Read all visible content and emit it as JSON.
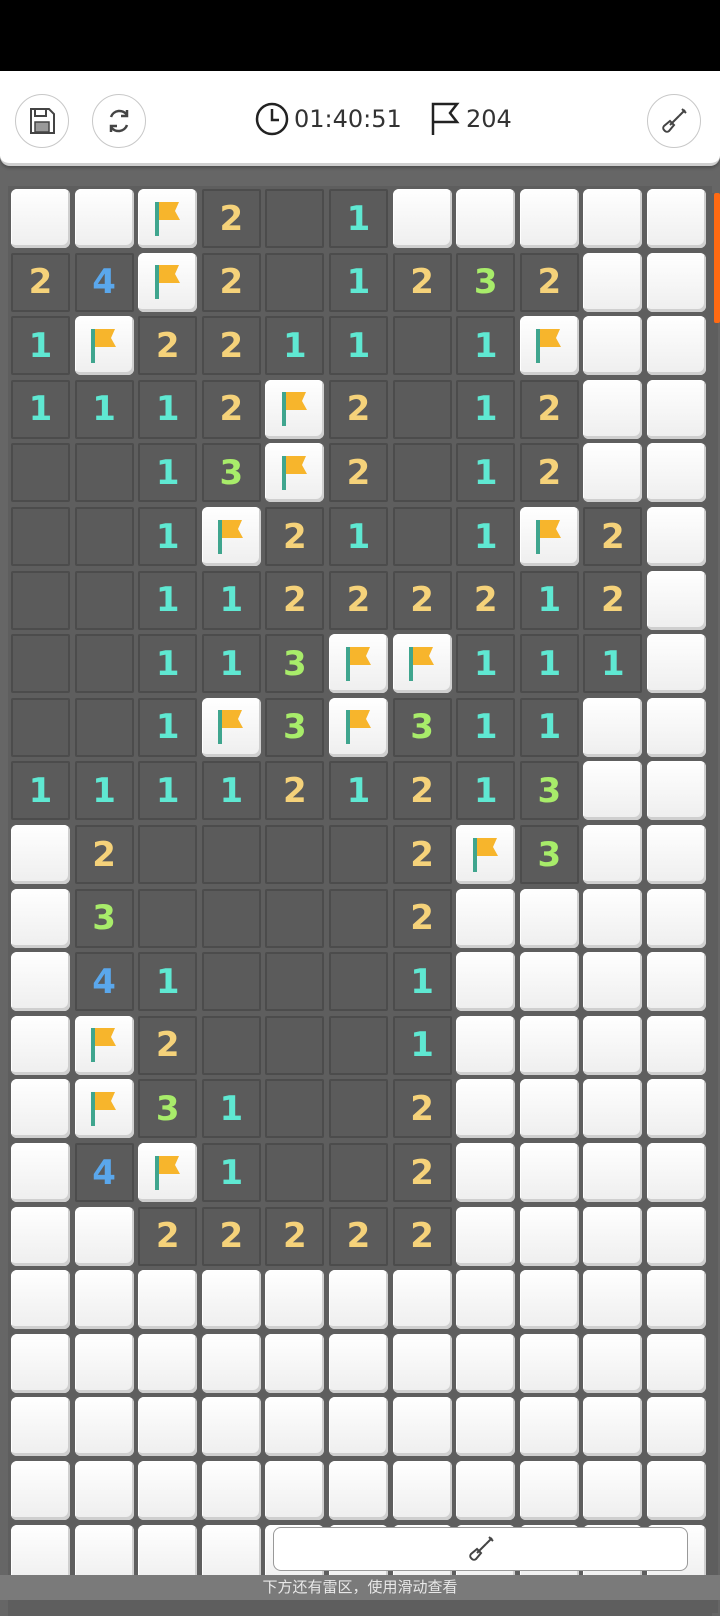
{
  "toolbar": {
    "timer": "01:40:51",
    "flag_count": "204",
    "icons": [
      "save-icon",
      "restart-icon",
      "clock-icon",
      "flag-icon",
      "shovel-icon"
    ]
  },
  "board": {
    "cols": 11,
    "visible_rows": 22,
    "legend": "C = covered, F = flagged, O = opened empty, digit = opened number",
    "rows": [
      [
        "C",
        "C",
        "F",
        "2",
        "O",
        "1",
        "C",
        "C",
        "C",
        "C",
        "C"
      ],
      [
        "2",
        "4",
        "F",
        "2",
        "O",
        "1",
        "2",
        "3",
        "2",
        "C",
        "C"
      ],
      [
        "1",
        "F",
        "2",
        "2",
        "1",
        "1",
        "O",
        "1",
        "F",
        "C",
        "C"
      ],
      [
        "1",
        "1",
        "1",
        "2",
        "F",
        "2",
        "O",
        "1",
        "2",
        "C",
        "C"
      ],
      [
        "O",
        "O",
        "1",
        "3",
        "F",
        "2",
        "O",
        "1",
        "2",
        "C",
        "C"
      ],
      [
        "O",
        "O",
        "1",
        "F",
        "2",
        "1",
        "O",
        "1",
        "F",
        "2",
        "C"
      ],
      [
        "O",
        "O",
        "1",
        "1",
        "2",
        "2",
        "2",
        "2",
        "1",
        "2",
        "C"
      ],
      [
        "O",
        "O",
        "1",
        "1",
        "3",
        "F",
        "F",
        "1",
        "1",
        "1",
        "C"
      ],
      [
        "O",
        "O",
        "1",
        "F",
        "3",
        "F",
        "3",
        "1",
        "1",
        "C",
        "C"
      ],
      [
        "1",
        "1",
        "1",
        "1",
        "2",
        "1",
        "2",
        "1",
        "3",
        "C",
        "C"
      ],
      [
        "C",
        "2",
        "O",
        "O",
        "O",
        "O",
        "2",
        "F",
        "3",
        "C",
        "C"
      ],
      [
        "C",
        "3",
        "O",
        "O",
        "O",
        "O",
        "2",
        "C",
        "C",
        "C",
        "C"
      ],
      [
        "C",
        "4",
        "1",
        "O",
        "O",
        "O",
        "1",
        "C",
        "C",
        "C",
        "C"
      ],
      [
        "C",
        "F",
        "2",
        "O",
        "O",
        "O",
        "1",
        "C",
        "C",
        "C",
        "C"
      ],
      [
        "C",
        "F",
        "3",
        "1",
        "O",
        "O",
        "2",
        "C",
        "C",
        "C",
        "C"
      ],
      [
        "C",
        "4",
        "F",
        "1",
        "O",
        "O",
        "2",
        "C",
        "C",
        "C",
        "C"
      ],
      [
        "C",
        "C",
        "2",
        "2",
        "2",
        "2",
        "2",
        "C",
        "C",
        "C",
        "C"
      ],
      [
        "C",
        "C",
        "C",
        "C",
        "C",
        "C",
        "C",
        "C",
        "C",
        "C",
        "C"
      ],
      [
        "C",
        "C",
        "C",
        "C",
        "C",
        "C",
        "C",
        "C",
        "C",
        "C",
        "C"
      ],
      [
        "C",
        "C",
        "C",
        "C",
        "C",
        "C",
        "C",
        "C",
        "C",
        "C",
        "C"
      ],
      [
        "C",
        "C",
        "C",
        "C",
        "C",
        "C",
        "C",
        "C",
        "C",
        "C",
        "C"
      ],
      [
        "C",
        "C",
        "C",
        "C",
        "C",
        "C",
        "C",
        "C",
        "C",
        "C",
        "C"
      ]
    ],
    "number_colors": {
      "1": "#5fe8d2",
      "2": "#f5d27a",
      "3": "#a8ec6a",
      "4": "#5aa7ec"
    },
    "flag_color": "#f7b52c"
  },
  "hint_text": "下方还有雷区，使用滑动查看",
  "accent_color": "#ff6a13"
}
